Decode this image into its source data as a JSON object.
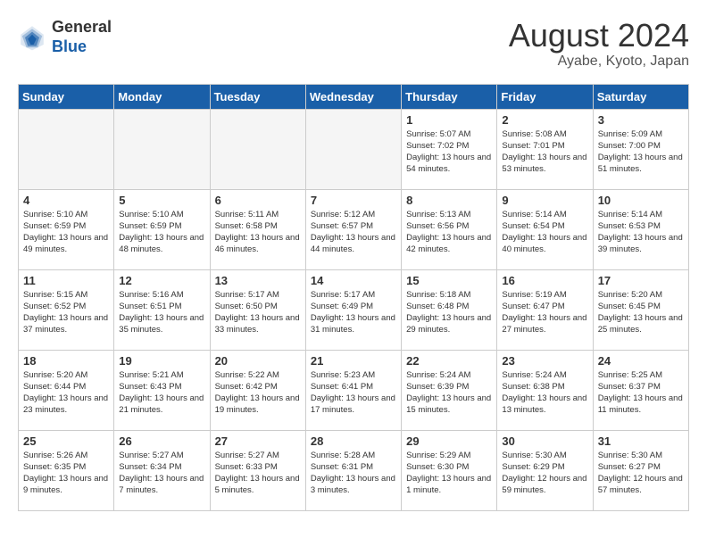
{
  "header": {
    "logo_line1": "General",
    "logo_line2": "Blue",
    "month_year": "August 2024",
    "location": "Ayabe, Kyoto, Japan"
  },
  "weekdays": [
    "Sunday",
    "Monday",
    "Tuesday",
    "Wednesday",
    "Thursday",
    "Friday",
    "Saturday"
  ],
  "weeks": [
    [
      {
        "day": "",
        "empty": true
      },
      {
        "day": "",
        "empty": true
      },
      {
        "day": "",
        "empty": true
      },
      {
        "day": "",
        "empty": true
      },
      {
        "day": "1",
        "sunrise": "5:07 AM",
        "sunset": "7:02 PM",
        "daylight": "13 hours and 54 minutes."
      },
      {
        "day": "2",
        "sunrise": "5:08 AM",
        "sunset": "7:01 PM",
        "daylight": "13 hours and 53 minutes."
      },
      {
        "day": "3",
        "sunrise": "5:09 AM",
        "sunset": "7:00 PM",
        "daylight": "13 hours and 51 minutes."
      }
    ],
    [
      {
        "day": "4",
        "sunrise": "5:10 AM",
        "sunset": "6:59 PM",
        "daylight": "13 hours and 49 minutes."
      },
      {
        "day": "5",
        "sunrise": "5:10 AM",
        "sunset": "6:59 PM",
        "daylight": "13 hours and 48 minutes."
      },
      {
        "day": "6",
        "sunrise": "5:11 AM",
        "sunset": "6:58 PM",
        "daylight": "13 hours and 46 minutes."
      },
      {
        "day": "7",
        "sunrise": "5:12 AM",
        "sunset": "6:57 PM",
        "daylight": "13 hours and 44 minutes."
      },
      {
        "day": "8",
        "sunrise": "5:13 AM",
        "sunset": "6:56 PM",
        "daylight": "13 hours and 42 minutes."
      },
      {
        "day": "9",
        "sunrise": "5:14 AM",
        "sunset": "6:54 PM",
        "daylight": "13 hours and 40 minutes."
      },
      {
        "day": "10",
        "sunrise": "5:14 AM",
        "sunset": "6:53 PM",
        "daylight": "13 hours and 39 minutes."
      }
    ],
    [
      {
        "day": "11",
        "sunrise": "5:15 AM",
        "sunset": "6:52 PM",
        "daylight": "13 hours and 37 minutes."
      },
      {
        "day": "12",
        "sunrise": "5:16 AM",
        "sunset": "6:51 PM",
        "daylight": "13 hours and 35 minutes."
      },
      {
        "day": "13",
        "sunrise": "5:17 AM",
        "sunset": "6:50 PM",
        "daylight": "13 hours and 33 minutes."
      },
      {
        "day": "14",
        "sunrise": "5:17 AM",
        "sunset": "6:49 PM",
        "daylight": "13 hours and 31 minutes."
      },
      {
        "day": "15",
        "sunrise": "5:18 AM",
        "sunset": "6:48 PM",
        "daylight": "13 hours and 29 minutes."
      },
      {
        "day": "16",
        "sunrise": "5:19 AM",
        "sunset": "6:47 PM",
        "daylight": "13 hours and 27 minutes."
      },
      {
        "day": "17",
        "sunrise": "5:20 AM",
        "sunset": "6:45 PM",
        "daylight": "13 hours and 25 minutes."
      }
    ],
    [
      {
        "day": "18",
        "sunrise": "5:20 AM",
        "sunset": "6:44 PM",
        "daylight": "13 hours and 23 minutes."
      },
      {
        "day": "19",
        "sunrise": "5:21 AM",
        "sunset": "6:43 PM",
        "daylight": "13 hours and 21 minutes."
      },
      {
        "day": "20",
        "sunrise": "5:22 AM",
        "sunset": "6:42 PM",
        "daylight": "13 hours and 19 minutes."
      },
      {
        "day": "21",
        "sunrise": "5:23 AM",
        "sunset": "6:41 PM",
        "daylight": "13 hours and 17 minutes."
      },
      {
        "day": "22",
        "sunrise": "5:24 AM",
        "sunset": "6:39 PM",
        "daylight": "13 hours and 15 minutes."
      },
      {
        "day": "23",
        "sunrise": "5:24 AM",
        "sunset": "6:38 PM",
        "daylight": "13 hours and 13 minutes."
      },
      {
        "day": "24",
        "sunrise": "5:25 AM",
        "sunset": "6:37 PM",
        "daylight": "13 hours and 11 minutes."
      }
    ],
    [
      {
        "day": "25",
        "sunrise": "5:26 AM",
        "sunset": "6:35 PM",
        "daylight": "13 hours and 9 minutes."
      },
      {
        "day": "26",
        "sunrise": "5:27 AM",
        "sunset": "6:34 PM",
        "daylight": "13 hours and 7 minutes."
      },
      {
        "day": "27",
        "sunrise": "5:27 AM",
        "sunset": "6:33 PM",
        "daylight": "13 hours and 5 minutes."
      },
      {
        "day": "28",
        "sunrise": "5:28 AM",
        "sunset": "6:31 PM",
        "daylight": "13 hours and 3 minutes."
      },
      {
        "day": "29",
        "sunrise": "5:29 AM",
        "sunset": "6:30 PM",
        "daylight": "13 hours and 1 minute."
      },
      {
        "day": "30",
        "sunrise": "5:30 AM",
        "sunset": "6:29 PM",
        "daylight": "12 hours and 59 minutes."
      },
      {
        "day": "31",
        "sunrise": "5:30 AM",
        "sunset": "6:27 PM",
        "daylight": "12 hours and 57 minutes."
      }
    ]
  ]
}
